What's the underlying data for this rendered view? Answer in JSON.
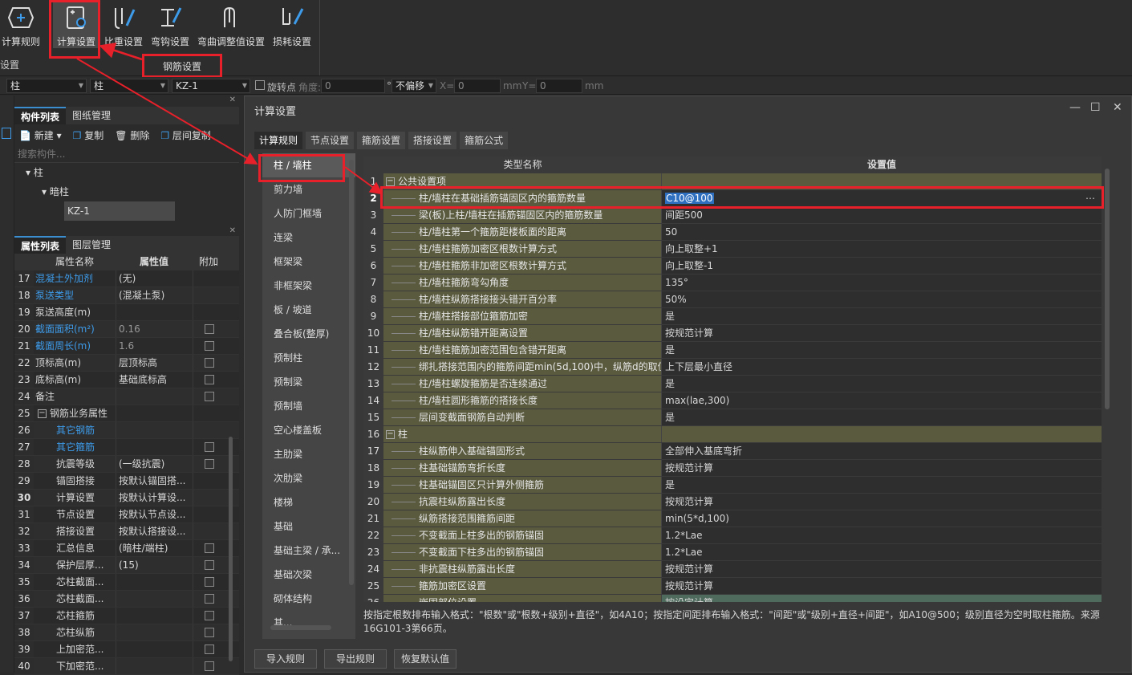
{
  "ribbon": {
    "buttons": [
      {
        "label": "计算规则",
        "icon": "calc-rule-icon"
      },
      {
        "label": "计算设置",
        "icon": "calc-settings-icon"
      },
      {
        "label": "比重设置",
        "icon": "weight-settings-icon"
      },
      {
        "label": "弯钩设置",
        "icon": "hook-settings-icon"
      },
      {
        "label": "弯曲调整值设置",
        "icon": "bend-adjust-icon"
      },
      {
        "label": "损耗设置",
        "icon": "loss-settings-icon"
      }
    ],
    "group_left": "设置",
    "group_main": "钢筋设置"
  },
  "toolbar2": {
    "dd1": "柱",
    "dd2": "柱",
    "dd3": "KZ-1",
    "rotate_label": "旋转点",
    "angle_label": "角度:",
    "angle_val": "0",
    "deg": "°",
    "offset": "不偏移",
    "x_label": "X=",
    "x_val": "0",
    "mm1": "mm",
    "y_label": "Y=",
    "y_val": "0",
    "mm2": "mm"
  },
  "left_top": {
    "tabs": [
      "构件列表",
      "图纸管理"
    ],
    "tools": [
      "新建",
      "复制",
      "删除",
      "层间复制"
    ],
    "search_placeholder": "搜索构件...",
    "tree": [
      "柱",
      "暗柱",
      "KZ-1"
    ]
  },
  "props": {
    "tabs": [
      "属性列表",
      "图层管理"
    ],
    "headers": [
      "属性名称",
      "属性值",
      "附加"
    ],
    "rows": [
      {
        "n": "17",
        "name": "混凝土外加剂",
        "val": "(无)",
        "blue": true,
        "chk": false
      },
      {
        "n": "18",
        "name": "泵送类型",
        "val": "(混凝土泵)",
        "blue": true,
        "chk": false
      },
      {
        "n": "19",
        "name": "泵送高度(m)",
        "val": "",
        "blue": false,
        "chk": false
      },
      {
        "n": "20",
        "name": "截面面积(m²)",
        "val": "0.16",
        "blue": true,
        "chk": true
      },
      {
        "n": "21",
        "name": "截面周长(m)",
        "val": "1.6",
        "blue": true,
        "chk": true
      },
      {
        "n": "22",
        "name": "顶标高(m)",
        "val": "层顶标高",
        "blue": false,
        "chk": true
      },
      {
        "n": "23",
        "name": "底标高(m)",
        "val": "基础底标高",
        "blue": false,
        "chk": true
      },
      {
        "n": "24",
        "name": "备注",
        "val": "",
        "blue": false,
        "chk": true
      },
      {
        "n": "25",
        "name": "钢筋业务属性",
        "val": "",
        "blue": false,
        "chk": false,
        "minus": true
      },
      {
        "n": "26",
        "name": "其它钢筋",
        "val": "",
        "blue": true,
        "chk": false,
        "indent": true
      },
      {
        "n": "27",
        "name": "其它箍筋",
        "val": "",
        "blue": true,
        "chk": true,
        "indent": true
      },
      {
        "n": "28",
        "name": "抗震等级",
        "val": "(一级抗震)",
        "blue": false,
        "chk": true,
        "indent": true
      },
      {
        "n": "29",
        "name": "锚固搭接",
        "val": "按默认锚固搭...",
        "blue": false,
        "chk": false,
        "indent": true
      },
      {
        "n": "30",
        "name": "计算设置",
        "val": "按默认计算设...",
        "blue": false,
        "chk": false,
        "indent": true,
        "bold": true
      },
      {
        "n": "31",
        "name": "节点设置",
        "val": "按默认节点设...",
        "blue": false,
        "chk": false,
        "indent": true
      },
      {
        "n": "32",
        "name": "搭接设置",
        "val": "按默认搭接设...",
        "blue": false,
        "chk": false,
        "indent": true
      },
      {
        "n": "33",
        "name": "汇总信息",
        "val": "(暗柱/端柱)",
        "blue": false,
        "chk": true,
        "indent": true
      },
      {
        "n": "34",
        "name": "保护层厚...",
        "val": "(15)",
        "blue": false,
        "chk": true,
        "indent": true
      },
      {
        "n": "35",
        "name": "芯柱截面...",
        "val": "",
        "blue": false,
        "chk": true,
        "indent": true
      },
      {
        "n": "36",
        "name": "芯柱截面...",
        "val": "",
        "blue": false,
        "chk": true,
        "indent": true
      },
      {
        "n": "37",
        "name": "芯柱箍筋",
        "val": "",
        "blue": false,
        "chk": true,
        "indent": true
      },
      {
        "n": "38",
        "name": "芯柱纵筋",
        "val": "",
        "blue": false,
        "chk": true,
        "indent": true
      },
      {
        "n": "39",
        "name": "上加密范...",
        "val": "",
        "blue": false,
        "chk": true,
        "indent": true
      },
      {
        "n": "40",
        "name": "下加密范...",
        "val": "",
        "blue": false,
        "chk": true,
        "indent": true
      }
    ]
  },
  "dialog": {
    "title": "计算设置",
    "tabs": [
      "计算规则",
      "节点设置",
      "箍筋设置",
      "搭接设置",
      "箍筋公式"
    ],
    "categories": [
      "柱 / 墙柱",
      "剪力墙",
      "人防门框墙",
      "连梁",
      "框架梁",
      "非框架梁",
      "板 / 坡道",
      "叠合板(整厚)",
      "预制柱",
      "预制梁",
      "预制墙",
      "空心楼盖板",
      "主肋梁",
      "次肋梁",
      "楼梯",
      "基础",
      "基础主梁 / 承...",
      "基础次梁",
      "砌体结构",
      "其..."
    ],
    "grid_headers": [
      "类型名称",
      "设置值"
    ],
    "rows": [
      {
        "n": "1",
        "name": "公共设置项",
        "val": "",
        "section": true
      },
      {
        "n": "2",
        "name": "柱/墙柱在基础插筋锚固区内的箍筋数量",
        "val": "C10@100",
        "selected": true
      },
      {
        "n": "3",
        "name": "梁(板)上柱/墙柱在插筋锚固区内的箍筋数量",
        "val": "间距500"
      },
      {
        "n": "4",
        "name": "柱/墙柱第一个箍筋距楼板面的距离",
        "val": "50"
      },
      {
        "n": "5",
        "name": "柱/墙柱箍筋加密区根数计算方式",
        "val": "向上取整+1"
      },
      {
        "n": "6",
        "name": "柱/墙柱箍筋非加密区根数计算方式",
        "val": "向上取整-1"
      },
      {
        "n": "7",
        "name": "柱/墙柱箍筋弯勾角度",
        "val": "135°"
      },
      {
        "n": "8",
        "name": "柱/墙柱纵筋搭接接头错开百分率",
        "val": "50%"
      },
      {
        "n": "9",
        "name": "柱/墙柱搭接部位箍筋加密",
        "val": "是"
      },
      {
        "n": "10",
        "name": "柱/墙柱纵筋错开距离设置",
        "val": "按规范计算"
      },
      {
        "n": "11",
        "name": "柱/墙柱箍筋加密范围包含错开距离",
        "val": "是"
      },
      {
        "n": "12",
        "name": "绑扎搭接范围内的箍筋间距min(5d,100)中，纵筋d的取值",
        "val": "上下层最小直径"
      },
      {
        "n": "13",
        "name": "柱/墙柱螺旋箍筋是否连续通过",
        "val": "是"
      },
      {
        "n": "14",
        "name": "柱/墙柱圆形箍筋的搭接长度",
        "val": "max(lae,300)"
      },
      {
        "n": "15",
        "name": "层间变截面钢筋自动判断",
        "val": "是"
      },
      {
        "n": "16",
        "name": "柱",
        "val": "",
        "section": true
      },
      {
        "n": "17",
        "name": "柱纵筋伸入基础锚固形式",
        "val": "全部伸入基底弯折"
      },
      {
        "n": "18",
        "name": "柱基础锚筋弯折长度",
        "val": "按规范计算"
      },
      {
        "n": "19",
        "name": "柱基础锚固区只计算外侧箍筋",
        "val": "是"
      },
      {
        "n": "20",
        "name": "抗震柱纵筋露出长度",
        "val": "按规范计算"
      },
      {
        "n": "21",
        "name": "纵筋搭接范围箍筋间距",
        "val": "min(5*d,100)"
      },
      {
        "n": "22",
        "name": "不变截面上柱多出的钢筋锚固",
        "val": "1.2*Lae"
      },
      {
        "n": "23",
        "name": "不变截面下柱多出的钢筋锚固",
        "val": "1.2*Lae"
      },
      {
        "n": "24",
        "name": "非抗震柱纵筋露出长度",
        "val": "按规范计算"
      },
      {
        "n": "25",
        "name": "箍筋加密区设置",
        "val": "按规范计算"
      },
      {
        "n": "26",
        "name": "嵌固部位设置",
        "val": "按设定计算",
        "last": true
      }
    ],
    "note": "按指定根数排布输入格式：\"根数\"或\"根数+级别+直径\"，如4A10；按指定间距排布输入格式：\"间距\"或\"级别+直径+间距\"，如A10@500；级别直径为空时取柱箍筋。来源16G101-3第66页。",
    "buttons": [
      "导入规则",
      "导出规则",
      "恢复默认值"
    ]
  },
  "colors": {
    "highlight_red": "#e8202a",
    "accent_blue": "#3d9be9",
    "name_cell": "#5a5a3f"
  }
}
